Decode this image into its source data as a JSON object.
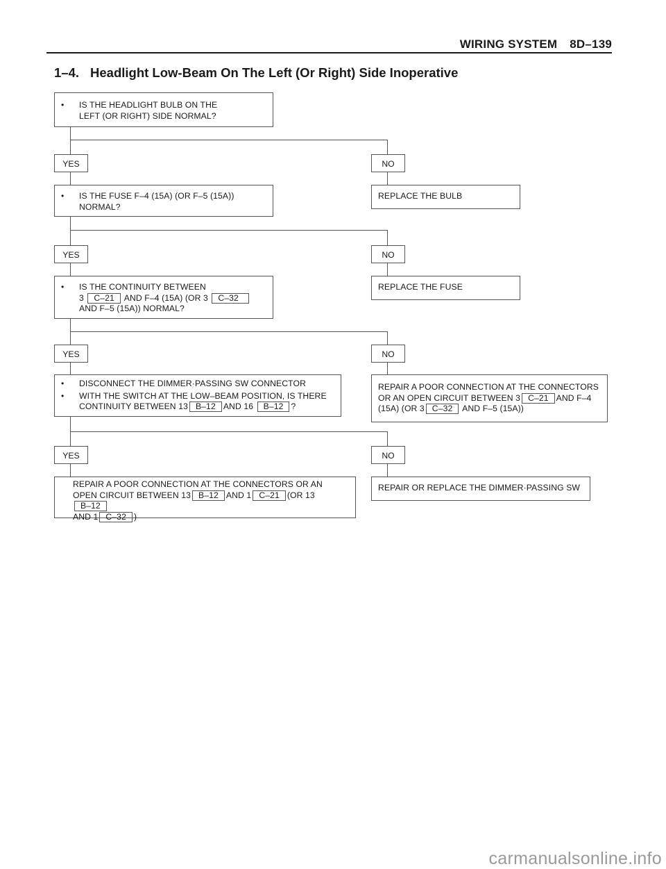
{
  "header": {
    "section": "WIRING SYSTEM",
    "page": "8D–139"
  },
  "title": {
    "number": "1–4.",
    "text": "Headlight Low-Beam On The Left (Or Right) Side Inoperative"
  },
  "flow": {
    "yes_label": "YES",
    "no_label": "NO",
    "bullet": "•",
    "step1": {
      "question": [
        "IS THE HEADLIGHT BULB ON THE",
        "LEFT (OR RIGHT) SIDE NORMAL?"
      ],
      "no_action": "REPLACE THE BULB"
    },
    "step2": {
      "question": [
        "IS THE FUSE F–4 (15A) (OR F–5 (15A))",
        "NORMAL?"
      ],
      "no_action": "REPLACE THE FUSE"
    },
    "step3": {
      "line1": "IS THE CONTINUITY BETWEEN",
      "l2_a": "3",
      "l2_conn1": "C–21",
      "l2_b": "AND F–4 (15A) (OR 3",
      "l2_conn2": "C–32",
      "line3": "AND F–5 (15A)) NORMAL?",
      "no_action": {
        "line1": "REPAIR A POOR CONNECTION AT THE CONNECTORS",
        "l2_a": "OR AN OPEN CIRCUIT BETWEEN 3",
        "l2_conn": "C–21",
        "l2_b": "AND F–4",
        "l3_a": "(15A) (OR 3",
        "l3_conn": "C–32",
        "l3_b": "AND F–5 (15A))"
      }
    },
    "step4": {
      "bullet1": "DISCONNECT THE DIMMER·PASSING SW CONNECTOR",
      "b2_line1": "WITH THE SWITCH AT THE LOW–BEAM POSITION, IS THERE",
      "b2_l2_a": "CONTINUITY BETWEEN 13",
      "b2_conn1": "B–12",
      "b2_l2_b": "AND 16",
      "b2_conn2": "B–12",
      "b2_l2_c": "?",
      "yes_action": {
        "line1": "REPAIR  A POOR CONNECTION AT THE CONNECTORS OR AN",
        "l2_a": "OPEN CIRCUIT BETWEEN 13",
        "l2_conn1": "B–12",
        "l2_b": "AND 1",
        "l2_conn2": "C–21",
        "l2_c": "(OR 13",
        "l2_conn3": "B–12",
        "l3_a": "AND 1",
        "l3_conn": "C–32",
        "l3_b": ")"
      },
      "no_action": "REPAIR OR REPLACE THE DIMMER·PASSING SW"
    }
  },
  "watermark": "carmanualsonline.info"
}
